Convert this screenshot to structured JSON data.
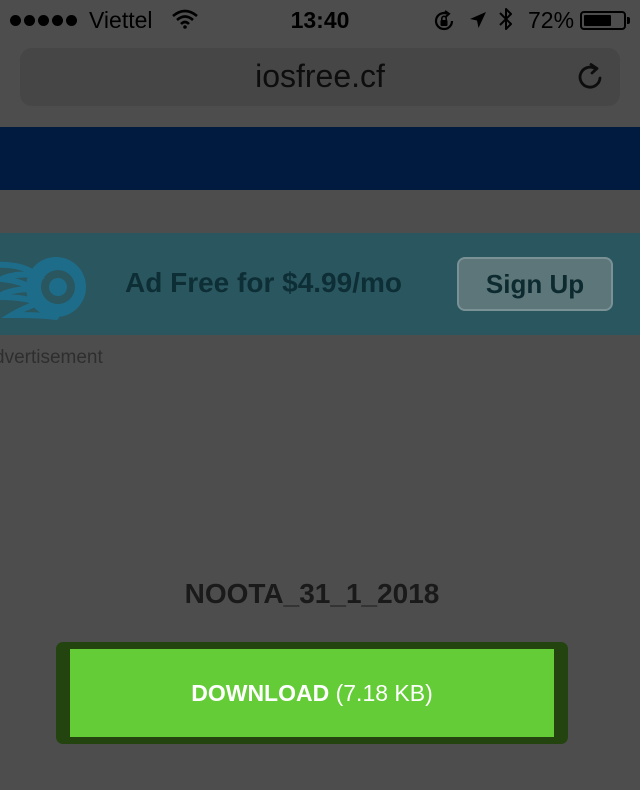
{
  "status_bar": {
    "carrier": "Viettel",
    "time": "13:40",
    "battery_percent_text": "72%",
    "battery_level": 0.72,
    "icons": [
      "signal-dots-icon",
      "wifi-icon",
      "rotation-lock-icon",
      "location-arrow-icon",
      "bluetooth-icon",
      "battery-icon"
    ]
  },
  "browser": {
    "url": "iosfree.cf",
    "reload_icon": "reload-icon"
  },
  "ad": {
    "text": "Ad Free for $4.99/mo",
    "button_label": "Sign Up",
    "label": "dvertisement",
    "logo_icon": "flame-logo-icon"
  },
  "file": {
    "name": "NOOTA_31_1_2018"
  },
  "download": {
    "label": "DOWNLOAD",
    "size": " (7.18 KB)"
  },
  "colors": {
    "page_overlay": "#4d4d4d",
    "site_header": "#001a40",
    "ad_background": "#2a5660",
    "download_green": "#64cc36",
    "download_frame": "#23440f"
  }
}
